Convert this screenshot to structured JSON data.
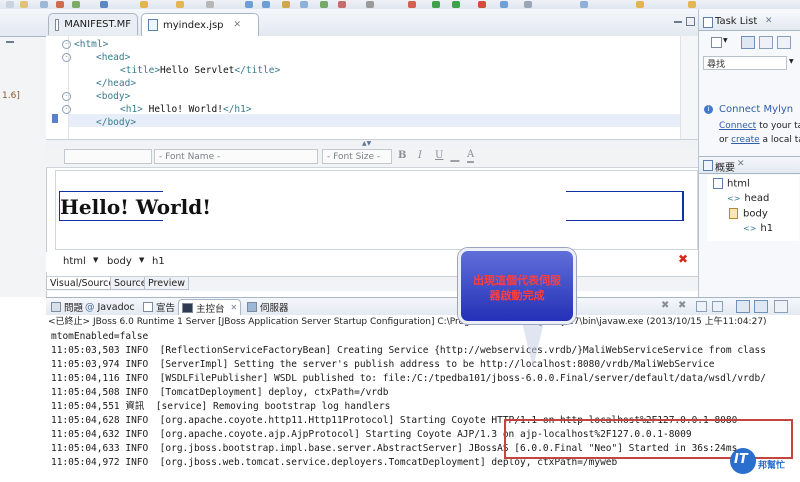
{
  "editor_tabs": [
    {
      "label": "MANIFEST.MF",
      "active": false
    },
    {
      "label": "myindex.jsp",
      "active": true
    }
  ],
  "left_stub_text": "1.6]",
  "code_lines": [
    {
      "indent": 0,
      "open": "<html>",
      "text": "",
      "close": ""
    },
    {
      "indent": 2,
      "open": "<head>",
      "text": "",
      "close": ""
    },
    {
      "indent": 4,
      "open": "<title>",
      "text": "Hello Servlet",
      "close": "</title>"
    },
    {
      "indent": 2,
      "open": "</head>",
      "text": "",
      "close": ""
    },
    {
      "indent": 2,
      "open": "<body>",
      "text": "",
      "close": ""
    },
    {
      "indent": 4,
      "open": "<h1>",
      "text": " Hello! World!",
      "close": "</h1>"
    },
    {
      "indent": 2,
      "open": "</body>",
      "text": "",
      "close": ""
    }
  ],
  "format_toolbar": {
    "font_name_placeholder": "- Font Name -",
    "font_size_placeholder": "- Font Size -",
    "bold": "B",
    "italic": "I",
    "underline": "U"
  },
  "preview": {
    "heading": "Hello! World!"
  },
  "breadcrumb": [
    "html",
    "body",
    "h1"
  ],
  "view_tabs": [
    "Visual/Source",
    "Source",
    "Preview"
  ],
  "task_list": {
    "title": "Task List",
    "find_placeholder": "尋找",
    "mylyn_title": "Connect Mylyn",
    "mylyn_line1_link": "Connect",
    "mylyn_line1_text": " to your tas",
    "mylyn_line2_prefix": "or ",
    "mylyn_line2_link": "create",
    "mylyn_line2_text": " a local tas"
  },
  "outline": {
    "title": "概要",
    "nodes": [
      {
        "label": "html",
        "depth": 0
      },
      {
        "label": "head",
        "depth": 1
      },
      {
        "label": "body",
        "depth": 1
      },
      {
        "label": "h1",
        "depth": 2
      }
    ]
  },
  "console_tabs": [
    {
      "label": "問題",
      "active": false
    },
    {
      "label": "Javadoc",
      "active": false
    },
    {
      "label": "宣告",
      "active": false
    },
    {
      "label": "主控台",
      "active": true
    },
    {
      "label": "伺服器",
      "active": false
    }
  ],
  "console_description": "<已終止> JBoss 6.0 Runtime 1 Server [JBoss Application Server Startup Configuration] C:\\Program Files (x86)\\Java\\jre7\\bin\\javaw.exe (2013/10/15 上午11:04:27)",
  "console_lines": [
    "mtomEnabled=false",
    "11:05:03,503 INFO  [ReflectionServiceFactoryBean] Creating Service {http://webservices.vrdb/}MaliWebServiceService from class",
    "11:05:03,974 INFO  [ServerImpl] Setting the server's publish address to be http://localhost:8080/vrdb/MaliWebService",
    "11:05:04,116 INFO  [WSDLFilePublisher] WSDL published to: file:/C:/tpedba101/jboss-6.0.0.Final/server/default/data/wsdl/vrdb/",
    "11:05:04,508 INFO  [TomcatDeployment] deploy, ctxPath=/vrdb",
    "11:05:04,551 資訊  [service] Removing bootstrap log handlers",
    "11:05:04,628 INFO  [org.apache.coyote.http11.Http11Protocol] Starting Coyote HTTP/1.1 on http-localhost%2F127.0.0.1-8080",
    "11:05:04,632 INFO  [org.apache.coyote.ajp.AjpProtocol] Starting Coyote AJP/1.3 on ajp-localhost%2F127.0.0.1-8009",
    "11:05:04,633 INFO  [org.jboss.bootstrap.impl.base.server.AbstractServer] JBossAS [6.0.0.Final \"Neo\"] Started in 36s:24ms",
    "11:05:04,972 INFO  [org.jboss.web.tomcat.service.deployers.TomcatDeployment] deploy, ctxPath=/myweb"
  ],
  "callout": {
    "line1": "出現這個代表伺服",
    "line2": "器啟動完成"
  },
  "watermark": {
    "big": "IT",
    "small": "邦幫忙"
  },
  "colors": {
    "accent": "#2430b7",
    "callout_text": "#ff3d3d",
    "highlight_box": "#c4453e"
  }
}
